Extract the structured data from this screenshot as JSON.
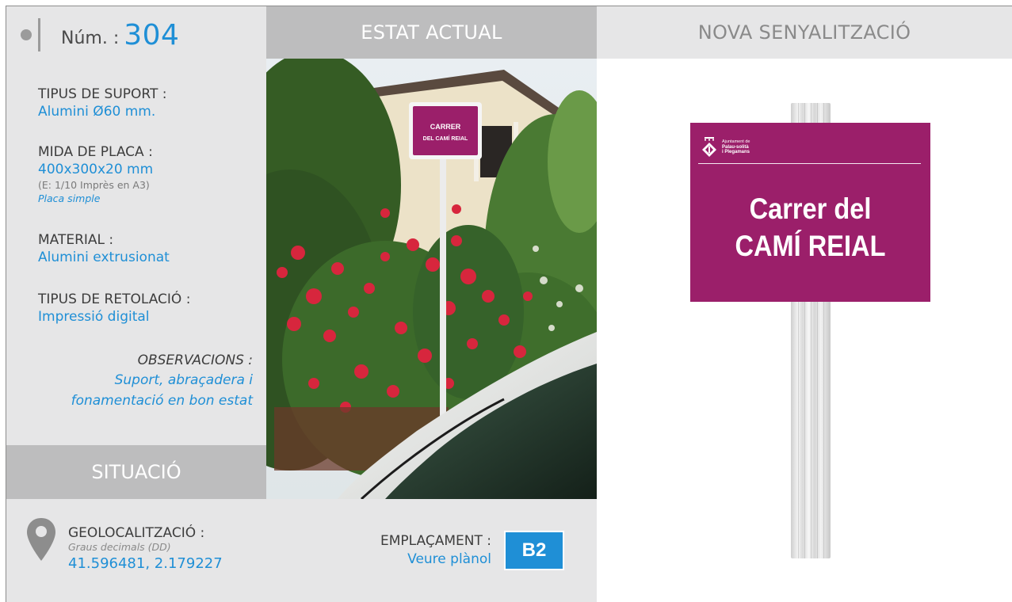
{
  "header": {
    "num_label": "Núm. :",
    "num_value": "304",
    "estat_actual": "ESTAT ACTUAL",
    "nova_senyalitzacio": "NOVA SENYALITZACIÓ"
  },
  "specs": {
    "tipus_suport": {
      "label": "TIPUS DE SUPORT :",
      "value": "Alumini Ø60 mm."
    },
    "mida_placa": {
      "label": "MIDA DE PLACA :",
      "value": "400x300x20 mm",
      "scale_note": "(E: 1/10 Imprès en A3)",
      "type_note": "Placa simple"
    },
    "material": {
      "label": "MATERIAL :",
      "value": "Alumini extrusionat"
    },
    "retolacio": {
      "label": "TIPUS DE RETOLACIÓ :",
      "value": "Impressió digital"
    },
    "observacions": {
      "label": "OBSERVACIONS :",
      "line1": "Suport, abraçadera i",
      "line2": "fonamentació en bon estat"
    }
  },
  "situacio": {
    "title": "SITUACIÓ",
    "geo_label": "GEOLOCALITZACIÓ :",
    "geo_sub": "Graus decimals (DD)",
    "geo_value": "41.596481, 2.179227",
    "empl_label": "EMPLAÇAMENT :",
    "empl_value": "Veure plànol",
    "empl_code": "B2"
  },
  "photo": {
    "sign_line1": "CARRER",
    "sign_line2": "DEL CAMÍ REIAL"
  },
  "new_sign": {
    "logo_line1": "Ajuntament de",
    "logo_line2": "Palau-solità",
    "logo_line3": "i Plegamans",
    "title_line1": "Carrer del",
    "title_line2": "CAMÍ REIAL"
  },
  "colors": {
    "accent_blue": "#1f8fd6",
    "panel_grey": "#e6e6e7",
    "header_grey": "#bdbdbe",
    "sign_magenta": "#9b1f6a"
  }
}
